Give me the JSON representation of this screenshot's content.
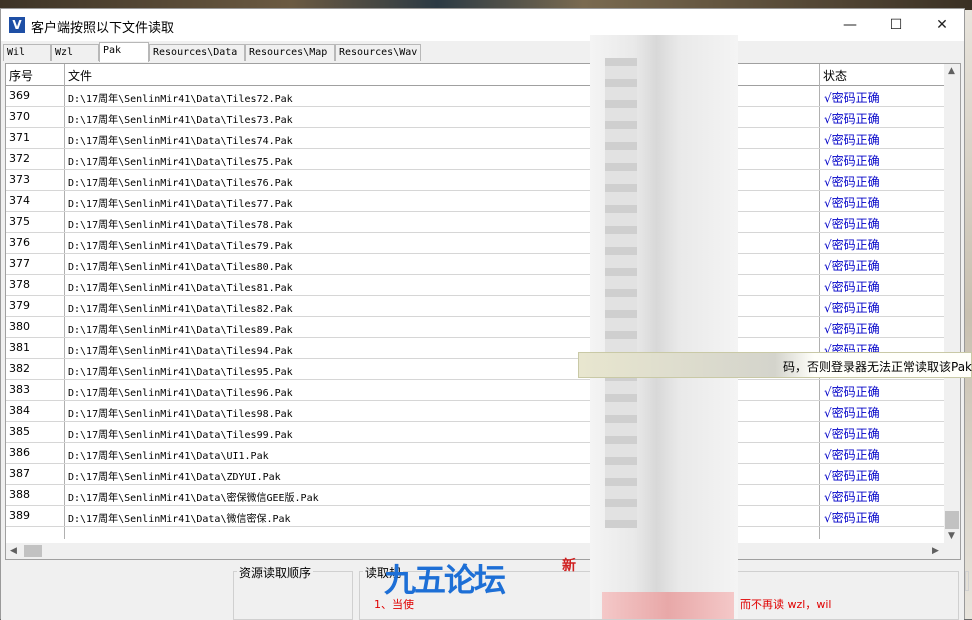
{
  "window": {
    "title": "客户端按照以下文件读取",
    "icon": "V"
  },
  "controls": {
    "minimize": "—",
    "maximize": "☐",
    "close": "✕"
  },
  "tabs": [
    "Wil",
    "Wzl",
    "Pak",
    "Resources\\Data",
    "Resources\\Map",
    "Resources\\Wav"
  ],
  "active_tab": "Pak",
  "table": {
    "columns": [
      "序号",
      "文件",
      "状态"
    ],
    "rows": [
      {
        "no": "369",
        "file": "D:\\17周年\\SenlinMir41\\Data\\Tiles72.Pak",
        "status": "√密码正确"
      },
      {
        "no": "370",
        "file": "D:\\17周年\\SenlinMir41\\Data\\Tiles73.Pak",
        "status": "√密码正确"
      },
      {
        "no": "371",
        "file": "D:\\17周年\\SenlinMir41\\Data\\Tiles74.Pak",
        "status": "√密码正确"
      },
      {
        "no": "372",
        "file": "D:\\17周年\\SenlinMir41\\Data\\Tiles75.Pak",
        "status": "√密码正确"
      },
      {
        "no": "373",
        "file": "D:\\17周年\\SenlinMir41\\Data\\Tiles76.Pak",
        "status": "√密码正确"
      },
      {
        "no": "374",
        "file": "D:\\17周年\\SenlinMir41\\Data\\Tiles77.Pak",
        "status": "√密码正确"
      },
      {
        "no": "375",
        "file": "D:\\17周年\\SenlinMir41\\Data\\Tiles78.Pak",
        "status": "√密码正确"
      },
      {
        "no": "376",
        "file": "D:\\17周年\\SenlinMir41\\Data\\Tiles79.Pak",
        "status": "√密码正确"
      },
      {
        "no": "377",
        "file": "D:\\17周年\\SenlinMir41\\Data\\Tiles80.Pak",
        "status": "√密码正确"
      },
      {
        "no": "378",
        "file": "D:\\17周年\\SenlinMir41\\Data\\Tiles81.Pak",
        "status": "√密码正确"
      },
      {
        "no": "379",
        "file": "D:\\17周年\\SenlinMir41\\Data\\Tiles82.Pak",
        "status": "√密码正确"
      },
      {
        "no": "380",
        "file": "D:\\17周年\\SenlinMir41\\Data\\Tiles89.Pak",
        "status": "√密码正确"
      },
      {
        "no": "381",
        "file": "D:\\17周年\\SenlinMir41\\Data\\Tiles94.Pak",
        "status": "√密码正确"
      },
      {
        "no": "382",
        "file": "D:\\17周年\\SenlinMir41\\Data\\Tiles95.Pak",
        "status": ""
      },
      {
        "no": "383",
        "file": "D:\\17周年\\SenlinMir41\\Data\\Tiles96.Pak",
        "status": "√密码正确"
      },
      {
        "no": "384",
        "file": "D:\\17周年\\SenlinMir41\\Data\\Tiles98.Pak",
        "status": "√密码正确"
      },
      {
        "no": "385",
        "file": "D:\\17周年\\SenlinMir41\\Data\\Tiles99.Pak",
        "status": "√密码正确"
      },
      {
        "no": "386",
        "file": "D:\\17周年\\SenlinMir41\\Data\\UI1.Pak",
        "status": "√密码正确"
      },
      {
        "no": "387",
        "file": "D:\\17周年\\SenlinMir41\\Data\\ZDYUI.Pak",
        "status": "√密码正确"
      },
      {
        "no": "388",
        "file": "D:\\17周年\\SenlinMir41\\Data\\密保微信GEE版.Pak",
        "status": "√密码正确"
      },
      {
        "no": "389",
        "file": "D:\\17周年\\SenlinMir41\\Data\\微信密保.Pak",
        "status": "√密码正确"
      }
    ]
  },
  "tooltip": "码，否则登录器无法正常读取该Pak文",
  "bottom": {
    "group1_label": "资源读取顺序",
    "group2_label": "读取规",
    "note": "1、当使",
    "note_tail": "而不再读 wzl，wil"
  },
  "watermark": {
    "text": "九五论坛",
    "badge": "新"
  },
  "colors": {
    "status": "#0000c8",
    "note": "#e00000"
  }
}
